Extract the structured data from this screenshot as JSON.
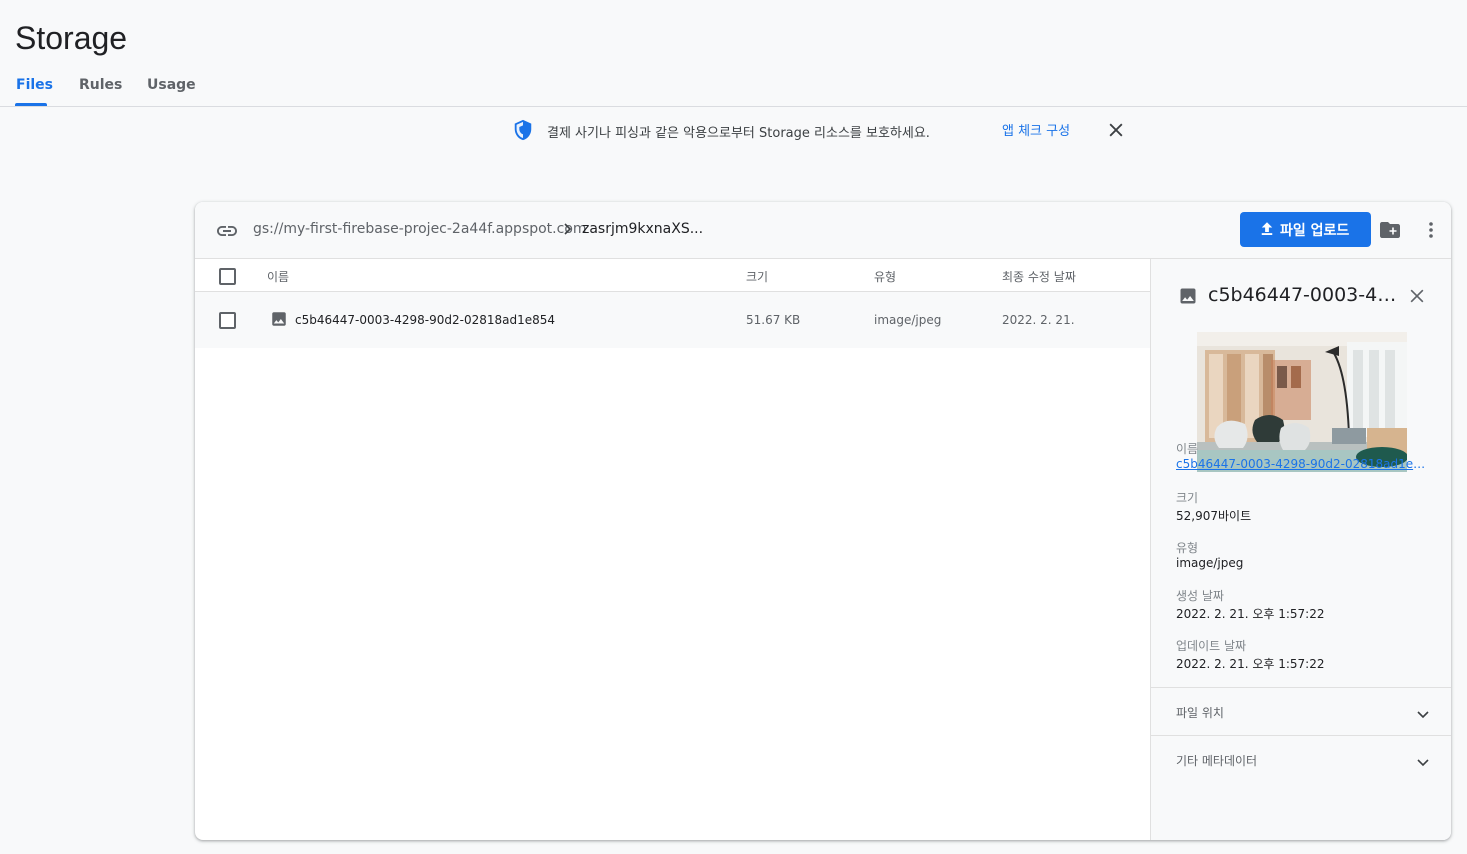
{
  "page": {
    "title": "Storage"
  },
  "tabs": [
    {
      "label": "Files",
      "active": true
    },
    {
      "label": "Rules",
      "active": false
    },
    {
      "label": "Usage",
      "active": false
    }
  ],
  "banner": {
    "icon": "shield-icon",
    "message": "결제 사기나 피싱과 같은 악용으로부터 Storage 리소스를 보호하세요.",
    "link": "앱 체크 구성"
  },
  "toolbar": {
    "bucket_path": "gs://my-first-firebase-projec-2a44f.appspot.com",
    "folder": "zasrjm9kxnaXS...",
    "upload_label": "파일 업로드"
  },
  "table": {
    "columns": {
      "name": "이름",
      "size": "크기",
      "type": "유형",
      "modified": "최종 수정 날짜"
    },
    "rows": [
      {
        "name": "c5b46447-0003-4298-90d2-02818ad1e854",
        "size": "51.67 KB",
        "type": "image/jpeg",
        "modified": "2022. 2. 21."
      }
    ]
  },
  "detail": {
    "title": "c5b46447-0003-42...",
    "name_label": "이름",
    "name_value": "c5b46447-0003-4298-90d2-02818ad1e85...",
    "size_label": "크기",
    "size_value": "52,907바이트",
    "type_label": "유형",
    "type_value": "image/jpeg",
    "created_label": "생성 날짜",
    "created_value": "2022. 2. 21. 오후 1:57:22",
    "updated_label": "업데이트 날짜",
    "updated_value": "2022. 2. 21. 오후 1:57:22",
    "section_location": "파일 위치",
    "section_metadata": "기타 메타데이터"
  },
  "colors": {
    "accent": "#1a73e8",
    "text": "#202124",
    "muted": "#5f6368"
  }
}
